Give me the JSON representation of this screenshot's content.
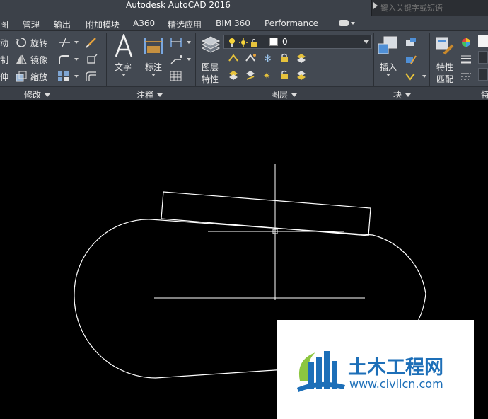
{
  "titlebar": {
    "title": "Autodesk AutoCAD 2016",
    "search_placeholder": "键入关键字或短语"
  },
  "menu": {
    "tabs": [
      "图",
      "管理",
      "输出",
      "附加模块",
      "A360",
      "精选应用",
      "BIM 360",
      "Performance"
    ]
  },
  "ribbon": {
    "modify": {
      "left_labels": [
        "动",
        "制",
        "伸"
      ],
      "rotate": "旋转",
      "mirror": "镜像",
      "scale": "缩放",
      "panel_label": "修改"
    },
    "annotation": {
      "text": "文字",
      "dimension": "标注",
      "panel_label": "注释"
    },
    "layers": {
      "properties_line1": "图层",
      "properties_line2": "特性",
      "current_layer": "0",
      "panel_label": "图层"
    },
    "block": {
      "insert": "插入",
      "panel_label": "块"
    },
    "properties": {
      "match_line1": "特性",
      "match_line2": "匹配",
      "panel_label": "特"
    }
  },
  "watermark": {
    "brand": "土木工程网",
    "url": "www.civilcn.com"
  },
  "colors": {
    "title_bg": "#3c4149",
    "ribbon_bg": "#434952",
    "canvas_bg": "#000000",
    "drawing_lines": "#ffffff",
    "brand_blue": "#1d6fb8",
    "brand_green": "#8cc63f"
  }
}
